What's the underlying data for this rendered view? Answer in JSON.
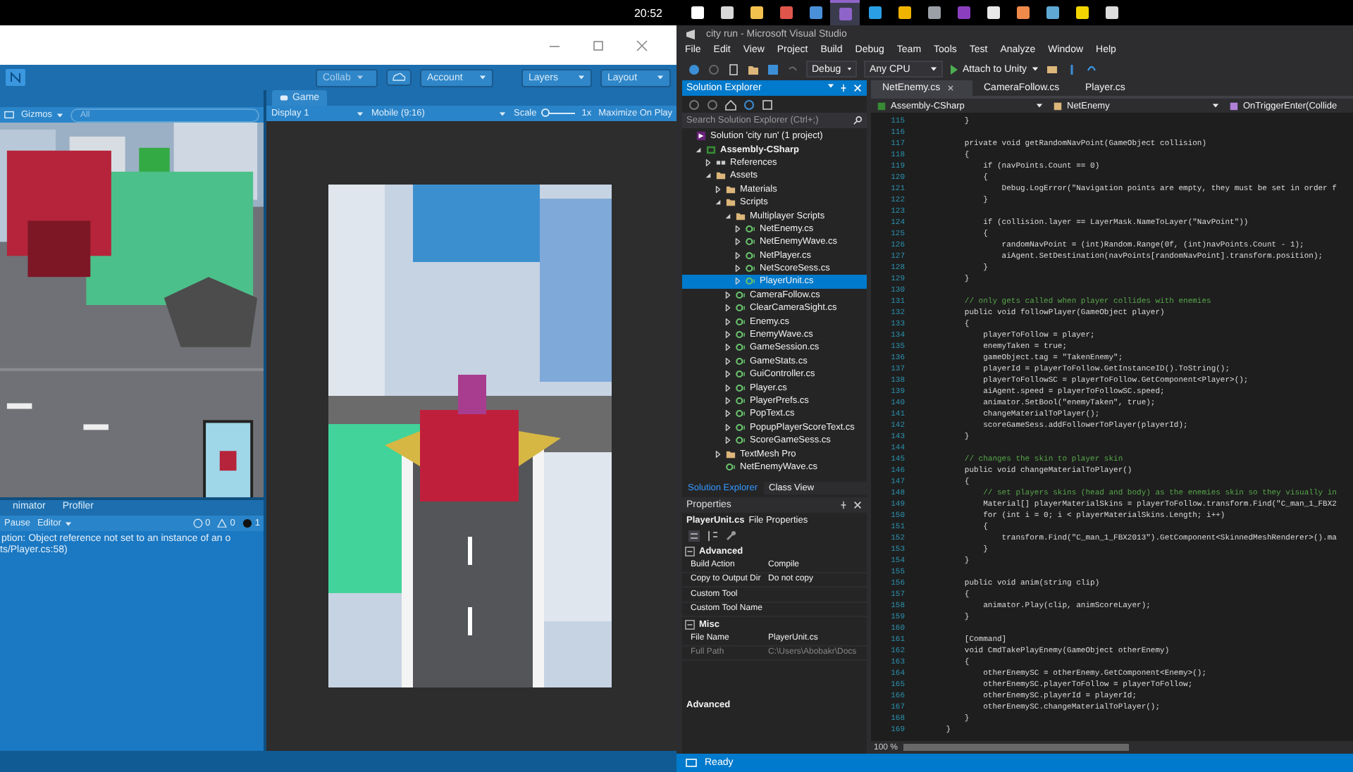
{
  "clock": "20:52",
  "taskbar": [
    {
      "color": "#ffffff",
      "selected": false
    },
    {
      "color": "#d8d8d8",
      "selected": false
    },
    {
      "color": "#f2c14e",
      "selected": false
    },
    {
      "color": "#e0554b",
      "selected": false
    },
    {
      "color": "#4a90d9",
      "selected": false
    },
    {
      "color": "#8f64c9",
      "selected": true
    },
    {
      "color": "#2b9fe6",
      "selected": false
    },
    {
      "color": "#f0b400",
      "selected": false
    },
    {
      "color": "#9aa0a6",
      "selected": false
    },
    {
      "color": "#8b3fbf",
      "selected": false
    },
    {
      "color": "#e8e8e8",
      "selected": false
    },
    {
      "color": "#f08a4b",
      "selected": false
    },
    {
      "color": "#5fa8d3",
      "selected": false
    },
    {
      "color": "#f2d600",
      "selected": false
    },
    {
      "color": "#dddddd",
      "selected": false
    }
  ],
  "unity": {
    "toolbar": {
      "collab": {
        "label": "Collab",
        "disabled": true
      },
      "account": "Account",
      "layers": "Layers",
      "layout": "Layout"
    },
    "scene": {
      "gizmos": "Gizmos",
      "search_placeholder": "All"
    },
    "game": {
      "tab": "Game",
      "display": "Display 1",
      "aspect": "Mobile (9:16)",
      "scale_label": "Scale",
      "scale": {
        "level": 0.05
      },
      "scale_value": "1x",
      "maximize": "Maximize On Play"
    },
    "console": {
      "tabs": [
        {
          "label": "nimator",
          "selected": false
        },
        {
          "label": "Profiler",
          "selected": false
        }
      ],
      "pause": "Pause",
      "editor": "Editor",
      "counts": [
        "0",
        "0",
        "1"
      ],
      "messages": [
        {
          "text": "ption: Object reference not set to an instance of an o",
          "detail": "ts/Player.cs:58)"
        }
      ]
    }
  },
  "vs": {
    "title": "city run - Microsoft Visual Studio",
    "menu": [
      "File",
      "Edit",
      "View",
      "Project",
      "Build",
      "Debug",
      "Team",
      "Tools",
      "Test",
      "Analyze",
      "Window",
      "Help"
    ],
    "toolbar": {
      "configuration": "Debug",
      "platform": "Any CPU",
      "attach": "Attach to Unity"
    },
    "solution_explorer": {
      "title": "Solution Explorer",
      "search_placeholder": "Search Solution Explorer (Ctrl+;)",
      "tree": [
        {
          "label": "Solution 'city run' (1 project)",
          "kind": "solution",
          "selected": false,
          "children": [
            {
              "label": "Assembly-CSharp",
              "kind": "project",
              "bold": true,
              "selected": false,
              "expanded": true,
              "children": [
                {
                  "label": "References",
                  "kind": "references",
                  "selected": false,
                  "expanded": false
                },
                {
                  "label": "Assets",
                  "kind": "folder",
                  "selected": false,
                  "expanded": true,
                  "children": [
                    {
                      "label": "Materials",
                      "kind": "folder",
                      "selected": false,
                      "expanded": false
                    },
                    {
                      "label": "Scripts",
                      "kind": "folder",
                      "selected": false,
                      "expanded": true,
                      "children": [
                        {
                          "label": "Multiplayer Scripts",
                          "kind": "folder",
                          "selected": false,
                          "expanded": true,
                          "children": [
                            {
                              "label": "NetEnemy.cs",
                              "kind": "cs",
                              "selected": false,
                              "expanded": false
                            },
                            {
                              "label": "NetEnemyWave.cs",
                              "kind": "cs",
                              "selected": false,
                              "expanded": false
                            },
                            {
                              "label": "NetPlayer.cs",
                              "kind": "cs",
                              "selected": false,
                              "expanded": false
                            },
                            {
                              "label": "NetScoreSess.cs",
                              "kind": "cs",
                              "selected": false,
                              "expanded": false
                            },
                            {
                              "label": "PlayerUnit.cs",
                              "kind": "cs",
                              "selected": true,
                              "expanded": false
                            }
                          ]
                        },
                        {
                          "label": "CameraFollow.cs",
                          "kind": "cs",
                          "selected": false,
                          "expanded": false
                        },
                        {
                          "label": "ClearCameraSight.cs",
                          "kind": "cs",
                          "selected": false,
                          "expanded": false
                        },
                        {
                          "label": "Enemy.cs",
                          "kind": "cs",
                          "selected": false,
                          "expanded": false
                        },
                        {
                          "label": "EnemyWave.cs",
                          "kind": "cs",
                          "selected": false,
                          "expanded": false
                        },
                        {
                          "label": "GameSession.cs",
                          "kind": "cs",
                          "selected": false,
                          "expanded": false
                        },
                        {
                          "label": "GameStats.cs",
                          "kind": "cs",
                          "selected": false,
                          "expanded": false
                        },
                        {
                          "label": "GuiController.cs",
                          "kind": "cs",
                          "selected": false,
                          "expanded": false
                        },
                        {
                          "label": "Player.cs",
                          "kind": "cs",
                          "selected": false,
                          "expanded": false
                        },
                        {
                          "label": "PlayerPrefs.cs",
                          "kind": "cs",
                          "selected": false,
                          "expanded": false
                        },
                        {
                          "label": "PopText.cs",
                          "kind": "cs",
                          "selected": false,
                          "expanded": false
                        },
                        {
                          "label": "PopupPlayerScoreText.cs",
                          "kind": "cs",
                          "selected": false,
                          "expanded": false
                        },
                        {
                          "label": "ScoreGameSess.cs",
                          "kind": "cs",
                          "selected": false,
                          "expanded": false
                        }
                      ]
                    },
                    {
                      "label": "TextMesh Pro",
                      "kind": "folder",
                      "selected": false,
                      "expanded": false
                    },
                    {
                      "label": "NetEnemyWave.cs",
                      "kind": "cs",
                      "selected": false
                    }
                  ]
                }
              ]
            }
          ]
        }
      ]
    },
    "panel_tabs": [
      {
        "label": "Solution Explorer",
        "selected": true
      },
      {
        "label": "Class View",
        "selected": false
      }
    ],
    "properties": {
      "title": "Properties",
      "object": "PlayerUnit.cs",
      "object_type": "File Properties",
      "sections": [
        {
          "name": "Advanced",
          "expanded": true,
          "rows": [
            {
              "name": "Build Action",
              "value": "Compile",
              "disabled": false
            },
            {
              "name": "Copy to Output Dir",
              "value": "Do not copy",
              "disabled": false
            },
            {
              "name": "Custom Tool",
              "disabled": false
            },
            {
              "name": "Custom Tool Name",
              "disabled": false
            }
          ]
        },
        {
          "name": "Misc",
          "expanded": true,
          "rows": [
            {
              "name": "File Name",
              "value": "PlayerUnit.cs",
              "disabled": false
            },
            {
              "name": "Full Path",
              "value": "C:\\Users\\Abobakr\\Docs",
              "disabled": true
            }
          ]
        }
      ],
      "description": "Advanced"
    },
    "editor": {
      "tabs": [
        {
          "label": "NetEnemy.cs",
          "selected": true
        },
        {
          "label": "CameraFollow.cs",
          "selected": false
        },
        {
          "label": "Player.cs",
          "selected": false
        }
      ],
      "nav": [
        "Assembly-CSharp",
        "NetEnemy",
        "OnTriggerEnter(Collide"
      ],
      "lines": [
        {
          "n": "115",
          "text": "        }",
          "kind": "code"
        },
        {
          "n": "116"
        },
        {
          "n": "117",
          "text": "        private void getRandomNavPoint(GameObject collision)",
          "kind": "code"
        },
        {
          "n": "118",
          "text": "        {",
          "kind": "code"
        },
        {
          "n": "119",
          "text": "            if (navPoints.Count == 0)",
          "kind": "code"
        },
        {
          "n": "120",
          "text": "            {",
          "kind": "code"
        },
        {
          "n": "121",
          "text": "                Debug.LogError(\"Navigation points are empty, they must be set in order f",
          "kind": "code"
        },
        {
          "n": "122",
          "text": "            }",
          "kind": "code"
        },
        {
          "n": "123"
        },
        {
          "n": "124",
          "text": "            if (collision.layer == LayerMask.NameToLayer(\"NavPoint\"))",
          "kind": "code"
        },
        {
          "n": "125",
          "text": "            {",
          "kind": "code"
        },
        {
          "n": "126",
          "text": "                randomNavPoint = (int)Random.Range(0f, (int)navPoints.Count - 1);",
          "kind": "code"
        },
        {
          "n": "127",
          "text": "                aiAgent.SetDestination(navPoints[randomNavPoint].transform.position);",
          "kind": "code"
        },
        {
          "n": "128",
          "text": "            }",
          "kind": "code"
        },
        {
          "n": "129",
          "text": "        }",
          "kind": "code"
        },
        {
          "n": "130"
        },
        {
          "n": "131",
          "text": "        // only gets called when player collides with enemies",
          "kind": "comment"
        },
        {
          "n": "132",
          "text": "        public void followPlayer(GameObject player)",
          "kind": "code"
        },
        {
          "n": "133",
          "text": "        {",
          "kind": "code"
        },
        {
          "n": "134",
          "text": "            playerToFollow = player;",
          "kind": "code"
        },
        {
          "n": "135",
          "text": "            enemyTaken = true;",
          "kind": "code"
        },
        {
          "n": "136",
          "text": "            gameObject.tag = \"TakenEnemy\";",
          "kind": "code"
        },
        {
          "n": "137",
          "text": "            playerId = playerToFollow.GetInstanceID().ToString();",
          "kind": "code"
        },
        {
          "n": "138",
          "text": "            playerToFollowSC = playerToFollow.GetComponent<Player>();",
          "kind": "code"
        },
        {
          "n": "139",
          "text": "            aiAgent.speed = playerToFollowSC.speed;",
          "kind": "code"
        },
        {
          "n": "140",
          "text": "            animator.SetBool(\"enemyTaken\", true);",
          "kind": "code"
        },
        {
          "n": "141",
          "text": "            changeMaterialToPlayer();",
          "kind": "code"
        },
        {
          "n": "142",
          "text": "            scoreGameSess.addFollowerToPlayer(playerId);",
          "kind": "code"
        },
        {
          "n": "143",
          "text": "        }",
          "kind": "code"
        },
        {
          "n": "144"
        },
        {
          "n": "145",
          "text": "        // changes the skin to player skin",
          "kind": "comment"
        },
        {
          "n": "146",
          "text": "        public void changeMaterialToPlayer()",
          "kind": "code"
        },
        {
          "n": "147",
          "text": "        {",
          "kind": "code"
        },
        {
          "n": "148",
          "text": "            // set players skins (head and body) as the enemies skin so they visually in",
          "kind": "comment"
        },
        {
          "n": "149",
          "text": "            Material[] playerMaterialSkins = playerToFollow.transform.Find(\"C_man_1_FBX2",
          "kind": "code"
        },
        {
          "n": "150",
          "text": "            for (int i = 0; i < playerMaterialSkins.Length; i++)",
          "kind": "code"
        },
        {
          "n": "151",
          "text": "            {",
          "kind": "code"
        },
        {
          "n": "152",
          "text": "                transform.Find(\"C_man_1_FBX2013\").GetComponent<SkinnedMeshRenderer>().ma",
          "kind": "code"
        },
        {
          "n": "153",
          "text": "            }",
          "kind": "code"
        },
        {
          "n": "154",
          "text": "        }",
          "kind": "code"
        },
        {
          "n": "155"
        },
        {
          "n": "156",
          "text": "        public void anim(string clip)",
          "kind": "code"
        },
        {
          "n": "157",
          "text": "        {",
          "kind": "code"
        },
        {
          "n": "158",
          "text": "            animator.Play(clip, animScoreLayer);",
          "kind": "code"
        },
        {
          "n": "159",
          "text": "        }",
          "kind": "code"
        },
        {
          "n": "160"
        },
        {
          "n": "161",
          "text": "        [Command]",
          "kind": "code"
        },
        {
          "n": "162",
          "text": "        void CmdTakePlayEnemy(GameObject otherEnemy)",
          "kind": "code"
        },
        {
          "n": "163",
          "text": "        {",
          "kind": "code"
        },
        {
          "n": "164",
          "text": "            otherEnemySC = otherEnemy.GetComponent<Enemy>();",
          "kind": "code"
        },
        {
          "n": "165",
          "text": "            otherEnemySC.playerToFollow = playerToFollow;",
          "kind": "code"
        },
        {
          "n": "166",
          "text": "            otherEnemySC.playerId = playerId;",
          "kind": "code"
        },
        {
          "n": "167",
          "text": "            otherEnemySC.changeMaterialToPlayer();",
          "kind": "code"
        },
        {
          "n": "168",
          "text": "        }",
          "kind": "code"
        },
        {
          "n": "169",
          "text": "    }",
          "kind": "code"
        }
      ],
      "zoom": "100 %"
    },
    "status": "Ready"
  }
}
